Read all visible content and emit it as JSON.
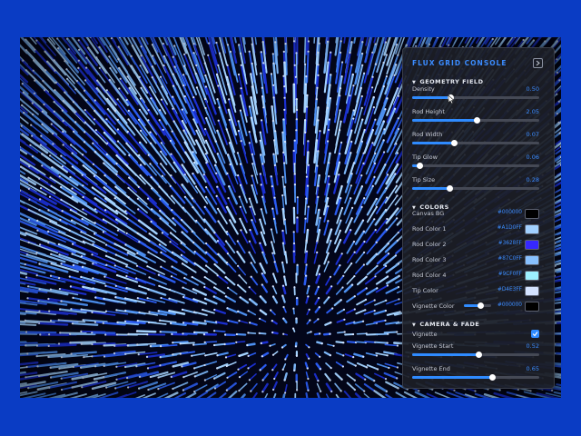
{
  "panel": {
    "title": "FLUX GRID CONSOLE",
    "sections": {
      "geometry": {
        "title": "GEOMETRY FIELD",
        "sliders": [
          {
            "label": "Density",
            "value": "0.50",
            "fraction": 0.3
          },
          {
            "label": "Rod Height",
            "value": "2.05",
            "fraction": 0.51
          },
          {
            "label": "Rod Width",
            "value": "0.07",
            "fraction": 0.33
          },
          {
            "label": "Tip Glow",
            "value": "0.06",
            "fraction": 0.06
          },
          {
            "label": "Tip Size",
            "value": "0.28",
            "fraction": 0.29
          }
        ]
      },
      "colors": {
        "title": "COLORS",
        "items": [
          {
            "label": "Canvas BG",
            "hex": "#000000",
            "color": "#000000"
          },
          {
            "label": "Rod Color 1",
            "hex": "#A1D0FF",
            "color": "#A1D0FF"
          },
          {
            "label": "Rod Color 2",
            "hex": "#3628FF",
            "color": "#3628FF"
          },
          {
            "label": "Rod Color 3",
            "hex": "#87C0FF",
            "color": "#87C0FF"
          },
          {
            "label": "Rod Color 4",
            "hex": "#9CF0FF",
            "color": "#9CF0FF"
          },
          {
            "label": "Tip Color",
            "hex": "#D4E3FF",
            "color": "#D4E3FF"
          }
        ],
        "vignette_color": {
          "label": "Vignette Color",
          "hex": "#000000",
          "color": "#000000",
          "fraction": 0.6
        }
      },
      "camera": {
        "title": "CAMERA & FADE",
        "vignette": {
          "label": "Vignette",
          "checked": true
        },
        "sliders": [
          {
            "label": "Vignette Start",
            "value": "0.52",
            "fraction": 0.52
          },
          {
            "label": "Vignette End",
            "value": "0.65",
            "fraction": 0.63
          }
        ]
      }
    }
  },
  "icons": {
    "collapse": "collapse-arrow-icon",
    "checkmark": "checkmark-icon",
    "cursor": "mouse-cursor-icon"
  },
  "accent_color": "#2f8bff",
  "visualization": {
    "type": "radial rod field",
    "rod_colors": [
      "#1b2fd1",
      "#2a5bef",
      "#4c8ff0",
      "#7cb6f7",
      "#a3d2ff"
    ]
  }
}
